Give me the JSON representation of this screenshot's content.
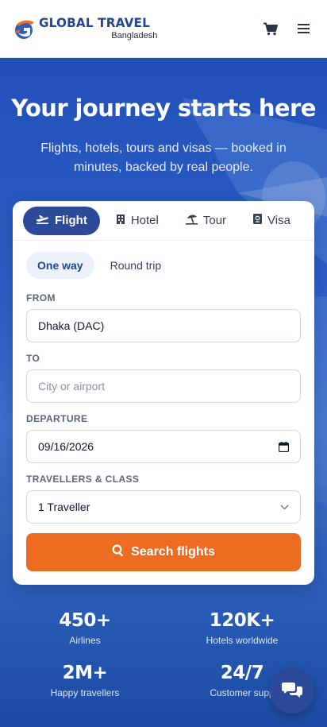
{
  "header": {
    "brand_name": "GLOBAL TRAVEL",
    "brand_sub": "Bangladesh",
    "icons": [
      "cart-icon",
      "hamburger-menu-icon"
    ]
  },
  "hero": {
    "title": "Your journey starts here",
    "subtitle": "Flights, hotels, tours and visas — booked in minutes, backed by real people."
  },
  "booking": {
    "tabs": [
      {
        "label": "Flight",
        "icon": "plane-icon",
        "active": true
      },
      {
        "label": "Hotel",
        "icon": "building-icon",
        "active": false
      },
      {
        "label": "Tour",
        "icon": "beach-umbrella-icon",
        "active": false
      },
      {
        "label": "Visa",
        "icon": "passport-icon",
        "active": false
      }
    ],
    "trip_types": [
      {
        "label": "One way",
        "active": true
      },
      {
        "label": "Round trip",
        "active": false
      }
    ],
    "from": {
      "label": "FROM",
      "value": "Dhaka (DAC)"
    },
    "to": {
      "label": "TO",
      "placeholder": "City or airport"
    },
    "departure": {
      "label": "DEPARTURE",
      "value": "09/16/2026"
    },
    "travellers": {
      "label": "TRAVELLERS & CLASS",
      "value": "1 Traveller"
    },
    "search_label": "Search flights"
  },
  "stats": [
    {
      "value": "450+",
      "label": "Airlines"
    },
    {
      "value": "120K+",
      "label": "Hotels worldwide"
    },
    {
      "value": "2M+",
      "label": "Happy travellers"
    },
    {
      "value": "24/7",
      "label": "Customer supp"
    }
  ],
  "colors": {
    "brand_navy": "#2c4a98",
    "brand_orange": "#ec6c22",
    "hero_blue": "#2a5ec8"
  }
}
